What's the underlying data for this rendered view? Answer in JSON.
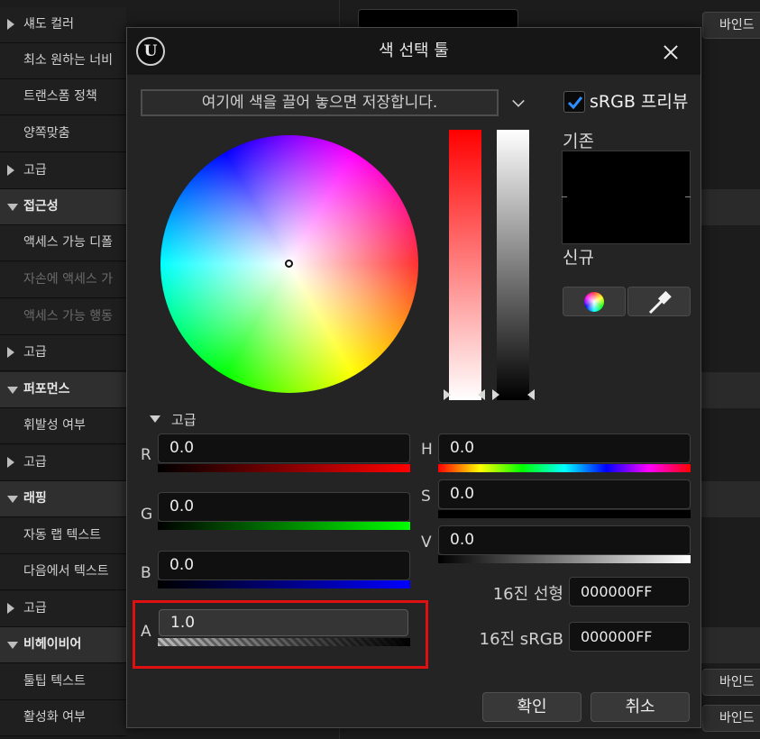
{
  "background_panel": {
    "rows": [
      {
        "label": "섀도 컬러",
        "kind": "sub-collapsed"
      },
      {
        "label": "최소 원하는 너비",
        "kind": "item"
      },
      {
        "label": "트랜스폼 정책",
        "kind": "item"
      },
      {
        "label": "양쪽맞춤",
        "kind": "item"
      },
      {
        "label": "고급",
        "kind": "sub-collapsed"
      },
      {
        "label": "접근성",
        "kind": "category"
      },
      {
        "label": "액세스 가능 디폴",
        "kind": "item"
      },
      {
        "label": "자손에 액세스 가",
        "kind": "item-dim"
      },
      {
        "label": "액세스 가능 행동",
        "kind": "item-dim"
      },
      {
        "label": "고급",
        "kind": "sub-collapsed"
      },
      {
        "label": "퍼포먼스",
        "kind": "category"
      },
      {
        "label": "휘발성 여부",
        "kind": "item"
      },
      {
        "label": "고급",
        "kind": "sub-collapsed"
      },
      {
        "label": "래핑",
        "kind": "category"
      },
      {
        "label": "자동 랩 텍스트",
        "kind": "item"
      },
      {
        "label": "다음에서 텍스트",
        "kind": "item"
      },
      {
        "label": "고급",
        "kind": "sub-collapsed"
      },
      {
        "label": "비헤이비어",
        "kind": "category"
      },
      {
        "label": "툴팁 텍스트",
        "kind": "item"
      },
      {
        "label": "활성화 여부",
        "kind": "item"
      }
    ],
    "bind_label": "바인드"
  },
  "dialog": {
    "title": "색 선택 툴",
    "logo_glyph": "U",
    "drop_zone_text": "여기에 색을 끌어 놓으면 저장합니다.",
    "srgb_preview_label": "sRGB 프리뷰",
    "srgb_preview_checked": true,
    "old_label": "기존",
    "new_label": "신규",
    "old_color": "#000000",
    "advanced_label": "고급",
    "channels_rgba": [
      {
        "label": "R",
        "value": "0.0"
      },
      {
        "label": "G",
        "value": "0.0"
      },
      {
        "label": "B",
        "value": "0.0"
      },
      {
        "label": "A",
        "value": "1.0"
      }
    ],
    "channels_hsv": [
      {
        "label": "H",
        "value": "0.0"
      },
      {
        "label": "S",
        "value": "0.0"
      },
      {
        "label": "V",
        "value": "0.0"
      }
    ],
    "hex_linear_label": "16진 선형",
    "hex_linear_value": "000000FF",
    "hex_srgb_label": "16진 sRGB",
    "hex_srgb_value": "000000FF",
    "ok_label": "확인",
    "cancel_label": "취소"
  },
  "colors": {
    "highlight": "#e01010",
    "check_accent": "#2f8fff"
  }
}
